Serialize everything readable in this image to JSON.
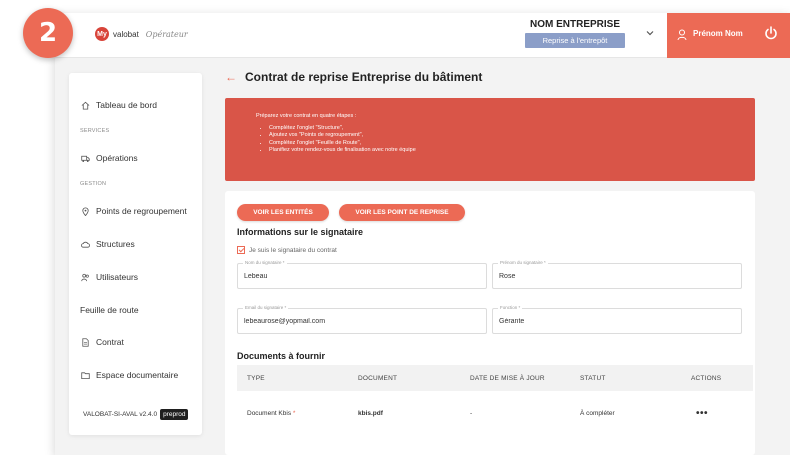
{
  "step": "2",
  "header": {
    "logo_mark": "My",
    "logo_text": "valobat",
    "logo_script": "Opérateur",
    "company_name": "NOM ENTREPRISE",
    "company_badge": "Reprise à l'entrepôt",
    "user_name": "Prénom Nom"
  },
  "sidebar": {
    "items": [
      {
        "label": "Tableau de bord",
        "icon": "home-icon"
      },
      {
        "label": "Opérations",
        "icon": "truck-icon"
      },
      {
        "label": "Points de regroupement",
        "icon": "map-pin-icon"
      },
      {
        "label": "Structures",
        "icon": "cloud-icon"
      },
      {
        "label": "Utilisateurs",
        "icon": "users-icon"
      },
      {
        "label": "Feuille de route"
      },
      {
        "label": "Contrat",
        "icon": "document-icon"
      },
      {
        "label": "Espace documentaire",
        "icon": "folder-icon"
      }
    ],
    "sections": [
      "SERVICES",
      "GESTION"
    ],
    "version": "VALOBAT-SI-AVAL v2.4.0",
    "env_badge": "preprod"
  },
  "page": {
    "title": "Contrat de reprise Entreprise du bâtiment",
    "info_heading": "Préparez votre contrat en quatre étapes :",
    "info_steps": [
      "Complétez l'onglet \"Structure\",",
      "Ajoutez vos \"Points de regroupement\",",
      "Complétez l'onglet \"Feuille de Route\",",
      "Planifiez votre rendez-vous de finalisation avec notre équipe"
    ],
    "btn_entities": "VOIR LES ENTITÉS",
    "btn_points": "VOIR LES POINT DE REPRISE",
    "signatory_title": "Informations sur le signataire",
    "checkbox_label": "Je suis le signataire du contrat",
    "fields": {
      "last_name": {
        "label": "Nom du signataire *",
        "value": "Lebeau"
      },
      "first_name": {
        "label": "Prénom du signataire *",
        "value": "Rose"
      },
      "email": {
        "label": "Email du signataire *",
        "value": "lebeaurose@yopmail.com"
      },
      "function": {
        "label": "Fonction *",
        "value": "Gérante"
      }
    },
    "documents_title": "Documents à fournir",
    "table": {
      "columns": [
        "TYPE",
        "DOCUMENT",
        "DATE DE MISE À JOUR",
        "STATUT",
        "ACTIONS"
      ],
      "rows": [
        {
          "type": "Document Kbis",
          "required": "*",
          "document": "kbis.pdf",
          "date": "-",
          "status": "À compléter",
          "actions": "•••"
        }
      ]
    }
  },
  "colors": {
    "accent": "#ec6a55",
    "info_bg": "#d95548",
    "badge": "#8b9ec8"
  }
}
